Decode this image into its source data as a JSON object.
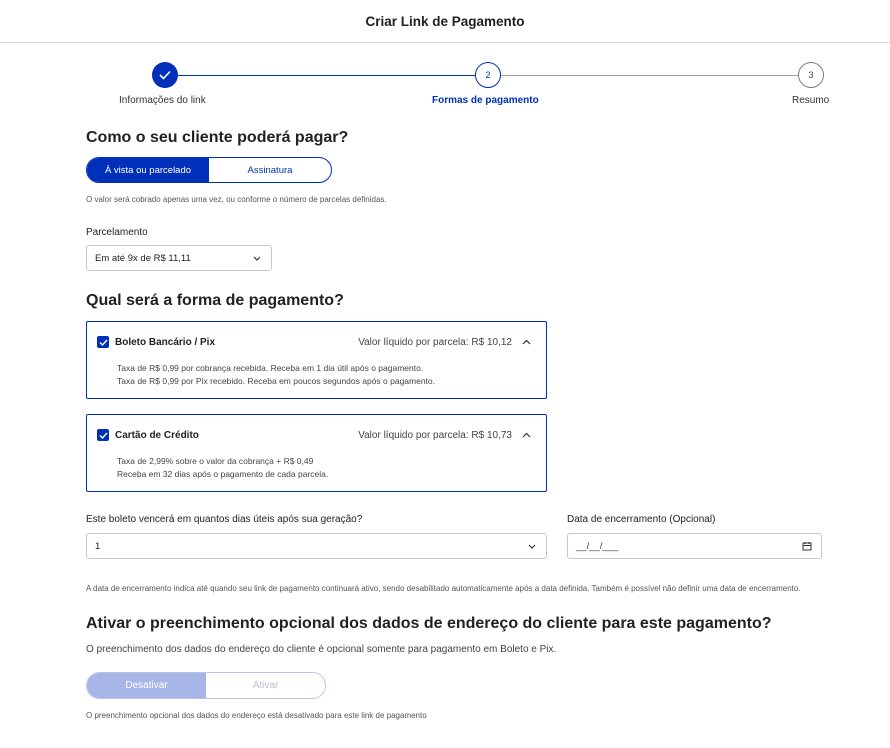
{
  "header": {
    "title": "Criar Link de Pagamento"
  },
  "stepper": {
    "steps": [
      {
        "label": "Informações do link",
        "number": ""
      },
      {
        "label": "Formas de pagamento",
        "number": "2"
      },
      {
        "label": "Resumo",
        "number": "3"
      }
    ]
  },
  "payment_type": {
    "heading": "Como o seu cliente poderá pagar?",
    "options": [
      "À vista ou parcelado",
      "Assinatura"
    ],
    "selected": "À vista ou parcelado",
    "hint": "O valor será cobrado apenas uma vez, ou conforme o número de parcelas definidas."
  },
  "installments": {
    "label": "Parcelamento",
    "value": "Em até 9x de R$ 11,11"
  },
  "payment_method": {
    "heading": "Qual será a forma de pagamento?",
    "boleto": {
      "name": "Boleto Bancário / Pix",
      "net": "Valor líquido por parcela: R$ 10,12",
      "checked": true,
      "desc1": "Taxa de R$ 0,99 por cobrança recebida. Receba em 1 dia útil após o pagamento.",
      "desc2": "Taxa de R$ 0,99 por Pix recebido. Receba em poucos segundos após o pagamento."
    },
    "card": {
      "name": "Cartão de Crédito",
      "net": "Valor líquido por parcela: R$ 10,73",
      "checked": true,
      "desc1": "Taxa de 2,99% sobre o valor da cobrança + R$ 0,49",
      "desc2": "Receba em 32 dias após o pagamento de cada parcela."
    }
  },
  "due_days": {
    "label": "Este boleto vencerá em quantos dias úteis após sua geração?",
    "value": "1"
  },
  "end_date": {
    "label": "Data de encerramento (Opcional)",
    "value": "__/__/___"
  },
  "end_date_hint": "A data de encerramento indica até quando seu link de pagamento continuará ativo, sendo desabilitado automaticamente após a data definida. Também é possível não definir uma data de encerramento.",
  "address": {
    "heading": "Ativar o preenchimento opcional dos dados de endereço do cliente para este pagamento?",
    "subtext": "O preenchimento dos dados do endereço do cliente é opcional somente para pagamento em Boleto e Pix.",
    "options": [
      "Desativar",
      "Ativar"
    ],
    "selected": "Desativar",
    "hint": "O preenchimento opcional dos dados do endereço está desativado para este link de pagamento"
  },
  "colors": {
    "primary": "#0030b9",
    "disabled_toggle": "#a7b6e6"
  }
}
